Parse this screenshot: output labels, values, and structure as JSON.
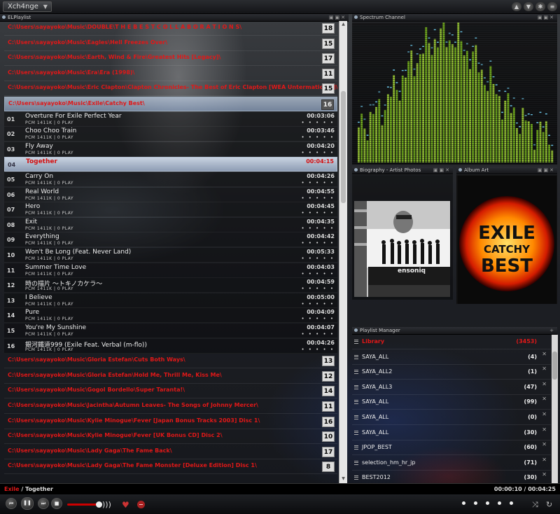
{
  "top_bar": {
    "skin_button": "Xch4nge"
  },
  "panels": {
    "playlist": "ELPlaylist",
    "spectrum": "Spectrum Channel",
    "artist": "Biography - Artist Photos",
    "album": "Album Art",
    "manager": "Playlist Manager"
  },
  "groups_top": [
    {
      "path": "C:\\Users\\sayayoko\\Music\\DOUBLE\\T H E   B E S T   C O L L A B O R A T I O N S\\",
      "count": "18"
    },
    {
      "path": "C:\\Users\\sayayoko\\Music\\Eagles\\Hell Freezes Over\\",
      "count": "15"
    },
    {
      "path": "C:\\Users\\sayayoko\\Music\\Earth, Wind & Fire\\Greatest Hits [Legacy]\\",
      "count": "17"
    },
    {
      "path": "C:\\Users\\sayayoko\\Music\\Era\\Era (1998)\\",
      "count": "11"
    },
    {
      "path": "C:\\Users\\sayayoko\\Music\\Eric Clapton\\Clapton Chronicles- The Best of Eric Clapton [WEA Untermational]\\",
      "count": "15"
    },
    {
      "path": "C:\\Users\\sayayoko\\Music\\Exile\\Catchy Best\\",
      "count": "16"
    }
  ],
  "track_subtitle": "PCM 1411K | 0 PLAY",
  "track_rating": "• • • • •",
  "tracks": [
    {
      "no": "01",
      "title": "Overture For Exile Perfect Year",
      "dur": "00:03:06"
    },
    {
      "no": "02",
      "title": "Choo Choo Train",
      "dur": "00:03:46"
    },
    {
      "no": "03",
      "title": "Fly Away",
      "dur": "00:04:20"
    },
    {
      "no": "04",
      "title": "Together",
      "dur": "00:04:15"
    },
    {
      "no": "05",
      "title": "Carry On",
      "dur": "00:04:26"
    },
    {
      "no": "06",
      "title": "Real World",
      "dur": "00:04:55"
    },
    {
      "no": "07",
      "title": "Hero",
      "dur": "00:04:45"
    },
    {
      "no": "08",
      "title": "Exit",
      "dur": "00:04:35"
    },
    {
      "no": "09",
      "title": "Everything",
      "dur": "00:04:42"
    },
    {
      "no": "10",
      "title": "Won't Be Long (Feat. Never Land)",
      "dur": "00:05:33"
    },
    {
      "no": "11",
      "title": "Summer Time Love",
      "dur": "00:04:03"
    },
    {
      "no": "12",
      "title": "時の描片 ～トキノカケラ～",
      "dur": "00:04:59"
    },
    {
      "no": "13",
      "title": "I Believe",
      "dur": "00:05:00"
    },
    {
      "no": "14",
      "title": "Pure",
      "dur": "00:04:09"
    },
    {
      "no": "15",
      "title": "You're My Sunshine",
      "dur": "00:04:07"
    },
    {
      "no": "16",
      "title": "銀河鐵道999 (Exile Feat. Verbal (m-flo))",
      "dur": "00:04:26"
    }
  ],
  "groups_bottom": [
    {
      "path": "C:\\Users\\sayayoko\\Music\\Gloria Estefan\\Cuts Both Ways\\",
      "count": "13"
    },
    {
      "path": "C:\\Users\\sayayoko\\Music\\Gloria Estefan\\Hold Me, Thrill Me, Kiss Me\\",
      "count": "12"
    },
    {
      "path": "C:\\Users\\sayayoko\\Music\\Gogol Bordello\\Super Taranta!\\",
      "count": "14"
    },
    {
      "path": "C:\\Users\\sayayoko\\Music\\Jacintha\\Autumn Leaves- The Songs of Johnny Mercer\\",
      "count": "11"
    },
    {
      "path": "C:\\Users\\sayayoko\\Music\\Kylie Minogue\\Fever [Japan Bonus Tracks 2003] Disc 1\\",
      "count": "16"
    },
    {
      "path": "C:\\Users\\sayayoko\\Music\\Kylie Minogue\\Fever [UK Bonus CD] Disc 2\\",
      "count": "10"
    },
    {
      "path": "C:\\Users\\sayayoko\\Music\\Lady Gaga\\The Fame Back\\",
      "count": "17"
    },
    {
      "path": "C:\\Users\\sayayoko\\Music\\Lady Gaga\\The Fame Monster [Deluxe Edition] Disc 1\\",
      "count": "8"
    }
  ],
  "album_art": {
    "line1": "EXILE",
    "line2": "CATCHY",
    "line3": "BEST"
  },
  "artist_photo": {
    "keyboard_brand": "ensoniq"
  },
  "playlists": [
    {
      "name": "Library",
      "count": "(3453)"
    },
    {
      "name": "SAYA_ALL",
      "count": "(4)"
    },
    {
      "name": "SAYA_ALL2",
      "count": "(1)"
    },
    {
      "name": "SAYA_ALL3",
      "count": "(47)"
    },
    {
      "name": "SAYA_ALL",
      "count": "(99)"
    },
    {
      "name": "SAYA_ALL",
      "count": "(0)"
    },
    {
      "name": "SAYA_ALL",
      "count": "(30)"
    },
    {
      "name": "JPOP_BEST",
      "count": "(60)"
    },
    {
      "name": "selection_hm_hr_jp",
      "count": "(71)"
    },
    {
      "name": "BEST2012",
      "count": "(30)"
    }
  ],
  "now_playing": {
    "artist": "Exile",
    "separator": " / ",
    "title": "Together",
    "elapsed": "00:00:10",
    "total": "00:04:25",
    "position": 0.04
  },
  "colors": {
    "accent": "#e01818",
    "selection": "#a8b8d0",
    "spectrum": "#8fd02a"
  }
}
